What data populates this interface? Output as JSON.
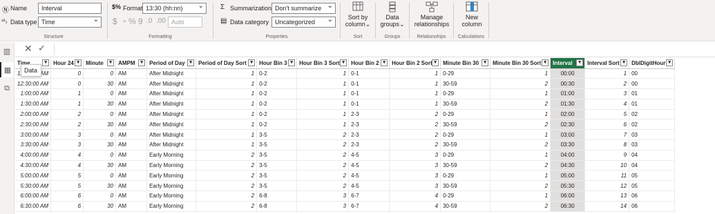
{
  "ribbon": {
    "structure": {
      "name_label": "Name",
      "name_value": "Interval",
      "datatype_label": "Data type",
      "datatype_value": "Time",
      "group_label": "Structure"
    },
    "formatting": {
      "format_label": "Format",
      "format_value": "13:30 (hh:nn)",
      "currency_symbol": "$",
      "percent_symbol": "%",
      "comma_symbol": "9",
      "auto_value": "Auto",
      "group_label": "Formatting"
    },
    "properties": {
      "summarization_label": "Summarization",
      "summarization_value": "Don't summarize",
      "category_label": "Data category",
      "category_value": "Uncategorized",
      "group_label": "Properties"
    },
    "sort": {
      "button_label_1": "Sort by",
      "button_label_2": "column",
      "group_label": "Sort"
    },
    "groups": {
      "button_label_1": "Data",
      "button_label_2": "groups",
      "group_label": "Groups"
    },
    "relationships": {
      "button_label_1": "Manage",
      "button_label_2": "relationships",
      "group_label": "Relationships"
    },
    "calculations": {
      "button_label_1": "New",
      "button_label_2": "column",
      "group_label": "Calculations"
    }
  },
  "tooltip": "Data",
  "table": {
    "columns": [
      "Time",
      "Hour 24",
      "Minute",
      "AMPM",
      "Period of Day",
      "Period of Day Sort",
      "Hour Bin 3",
      "Hour Bin 3 Sort",
      "Hour Bin 2",
      "Hour Bin 2 Sort",
      "Minute Bin 30",
      "Minute Bin 30 Sort",
      "Interval",
      "Interval Sort",
      "DblDigitHour"
    ],
    "rows": [
      [
        "12:00:00 AM",
        "0",
        "0",
        "AM",
        "After Midnight",
        "1",
        "0-2",
        "1",
        "0-1",
        "1",
        "0-29",
        "1",
        "00:00",
        "1",
        "00"
      ],
      [
        "12:30:00 AM",
        "0",
        "30",
        "AM",
        "After Midnight",
        "1",
        "0-2",
        "1",
        "0-1",
        "1",
        "30-59",
        "2",
        "00:30",
        "2",
        "00"
      ],
      [
        "1:00:00 AM",
        "1",
        "0",
        "AM",
        "After Midnight",
        "1",
        "0-2",
        "1",
        "0-1",
        "1",
        "0-29",
        "1",
        "01:00",
        "3",
        "01"
      ],
      [
        "1:30:00 AM",
        "1",
        "30",
        "AM",
        "After Midnight",
        "1",
        "0-2",
        "1",
        "0-1",
        "1",
        "30-59",
        "2",
        "01:30",
        "4",
        "01"
      ],
      [
        "2:00:00 AM",
        "2",
        "0",
        "AM",
        "After Midnight",
        "1",
        "0-2",
        "1",
        "2-3",
        "2",
        "0-29",
        "1",
        "02:00",
        "5",
        "02"
      ],
      [
        "2:30:00 AM",
        "2",
        "30",
        "AM",
        "After Midnight",
        "1",
        "0-2",
        "1",
        "2-3",
        "2",
        "30-59",
        "2",
        "02:30",
        "6",
        "02"
      ],
      [
        "3:00:00 AM",
        "3",
        "0",
        "AM",
        "After Midnight",
        "1",
        "3-5",
        "2",
        "2-3",
        "2",
        "0-29",
        "1",
        "03:00",
        "7",
        "03"
      ],
      [
        "3:30:00 AM",
        "3",
        "30",
        "AM",
        "After Midnight",
        "1",
        "3-5",
        "2",
        "2-3",
        "2",
        "30-59",
        "2",
        "03:30",
        "8",
        "03"
      ],
      [
        "4:00:00 AM",
        "4",
        "0",
        "AM",
        "Early Morning",
        "2",
        "3-5",
        "2",
        "4-5",
        "3",
        "0-29",
        "1",
        "04:00",
        "9",
        "04"
      ],
      [
        "4:30:00 AM",
        "4",
        "30",
        "AM",
        "Early Morning",
        "2",
        "3-5",
        "2",
        "4-5",
        "3",
        "30-59",
        "2",
        "04:30",
        "10",
        "04"
      ],
      [
        "5:00:00 AM",
        "5",
        "0",
        "AM",
        "Early Morning",
        "2",
        "3-5",
        "2",
        "4-5",
        "3",
        "0-29",
        "1",
        "05:00",
        "11",
        "05"
      ],
      [
        "5:30:00 AM",
        "5",
        "30",
        "AM",
        "Early Morning",
        "2",
        "3-5",
        "2",
        "4-5",
        "3",
        "30-59",
        "2",
        "05:30",
        "12",
        "05"
      ],
      [
        "6:00:00 AM",
        "6",
        "0",
        "AM",
        "Early Morning",
        "2",
        "6-8",
        "3",
        "6-7",
        "4",
        "0-29",
        "1",
        "06:00",
        "13",
        "06"
      ],
      [
        "6:30:00 AM",
        "6",
        "30",
        "AM",
        "Early Morning",
        "2",
        "6-8",
        "3",
        "6-7",
        "4",
        "30-59",
        "2",
        "06:30",
        "14",
        "06"
      ]
    ]
  },
  "colors": {
    "accent": "#217346",
    "ribbon_bg": "#f3f2f1",
    "selected_col": "#e1dfdd"
  }
}
